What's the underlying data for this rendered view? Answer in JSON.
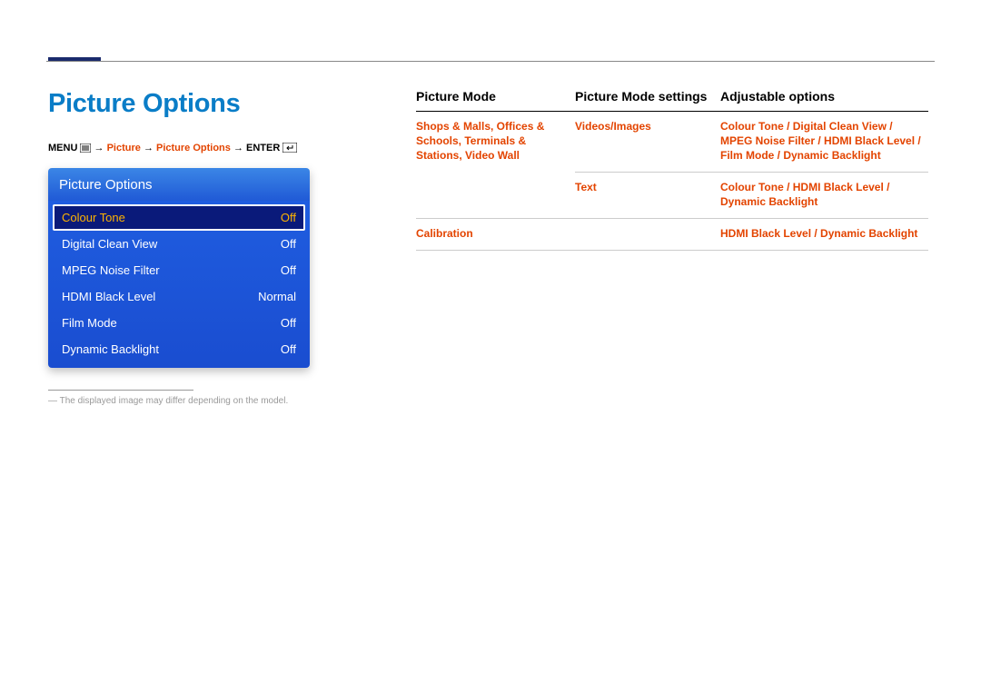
{
  "page": {
    "title": "Picture Options"
  },
  "breadcrumb": {
    "menu_label": "MENU",
    "arrow": " → ",
    "p1": "Picture",
    "p2": "Picture Options",
    "enter_label": "ENTER"
  },
  "menu": {
    "header": "Picture Options",
    "items": [
      {
        "label": "Colour Tone",
        "value": "Off",
        "selected": true
      },
      {
        "label": "Digital Clean View",
        "value": "Off",
        "selected": false
      },
      {
        "label": "MPEG Noise Filter",
        "value": "Off",
        "selected": false
      },
      {
        "label": "HDMI Black Level",
        "value": "Normal",
        "selected": false
      },
      {
        "label": "Film Mode",
        "value": "Off",
        "selected": false
      },
      {
        "label": "Dynamic Backlight",
        "value": "Off",
        "selected": false
      }
    ]
  },
  "footnote": "― The displayed image may differ depending on the model.",
  "table": {
    "headers": {
      "mode": "Picture Mode",
      "settings": "Picture Mode settings",
      "options": "Adjustable options"
    },
    "rows": [
      {
        "mode": "Shops & Malls, Offices & Schools, Terminals & Stations, Video Wall",
        "settings": "Videos/Images",
        "options": "Colour Tone / Digital Clean View / MPEG Noise Filter / HDMI Black Level / Film Mode / Dynamic Backlight"
      },
      {
        "mode": "",
        "settings": "Text",
        "options": "Colour Tone / HDMI Black Level / Dynamic Backlight"
      },
      {
        "mode": "Calibration",
        "settings": "",
        "options": "HDMI Black Level / Dynamic Backlight"
      }
    ]
  }
}
